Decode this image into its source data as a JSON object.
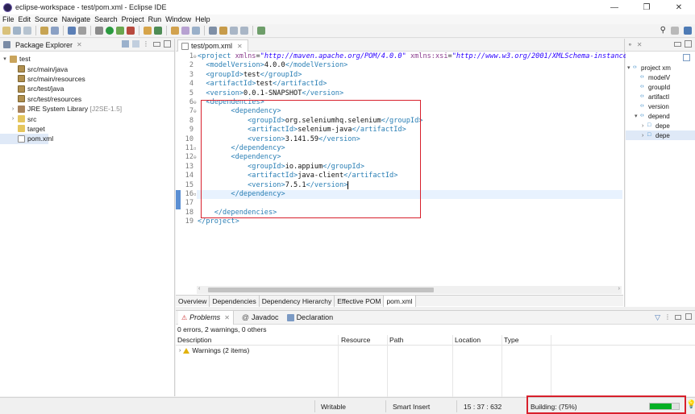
{
  "window": {
    "title": "eclipse-workspace - test/pom.xml - Eclipse IDE",
    "minimize": "—",
    "maximize": "❐",
    "close": "✕"
  },
  "menu": [
    "File",
    "Edit",
    "Source",
    "Navigate",
    "Search",
    "Project",
    "Run",
    "Window",
    "Help"
  ],
  "package_explorer": {
    "title": "Package Explorer",
    "items": [
      {
        "label": "test",
        "icon": "project-icon",
        "expanded": true,
        "level": 0
      },
      {
        "label": "src/main/java",
        "icon": "package-folder-icon",
        "level": 1
      },
      {
        "label": "src/main/resources",
        "icon": "package-folder-icon",
        "level": 1
      },
      {
        "label": "src/test/java",
        "icon": "package-folder-icon",
        "level": 1
      },
      {
        "label": "src/test/resources",
        "icon": "package-folder-icon",
        "level": 1
      },
      {
        "label": "JRE System Library",
        "suffix": "[J2SE-1.5]",
        "icon": "library-icon",
        "level": 1,
        "collapsed": true
      },
      {
        "label": "src",
        "icon": "folder-icon",
        "level": 1,
        "collapsed": true
      },
      {
        "label": "target",
        "icon": "folder-icon",
        "level": 1
      },
      {
        "label": "pom.xml",
        "icon": "xml-file-icon",
        "level": 1,
        "selected": true
      }
    ]
  },
  "editor": {
    "tab_label": "test/pom.xml",
    "lines": [
      "<project xmlns=\"http://maven.apache.org/POM/4.0.0\" xmlns:xsi=\"http://www.w3.org/2001/XMLSchema-instance\"",
      "  <modelVersion>4.0.0</modelVersion>",
      "  <groupId>test</groupId>",
      "  <artifactId>test</artifactId>",
      "  <version>0.0.1-SNAPSHOT</version>",
      "  <dependencies>",
      "        <dependency>",
      "            <groupId>org.seleniumhq.selenium</groupId>",
      "            <artifactId>selenium-java</artifactId>",
      "            <version>3.141.59</version>",
      "        </dependency>",
      "        <dependency>",
      "            <groupId>io.appium</groupId>",
      "            <artifactId>java-client</artifactId>",
      "            <version>7.5.1</version>",
      "        </dependency>",
      "",
      "    </dependencies>",
      "</project>"
    ],
    "line_numbers": [
      "1",
      "2",
      "3",
      "4",
      "5",
      "6",
      "7",
      "8",
      "9",
      "10",
      "11",
      "12",
      "13",
      "14",
      "15",
      "16",
      "17",
      "18",
      "19"
    ],
    "bottom_tabs": [
      "Overview",
      "Dependencies",
      "Dependency Hierarchy",
      "Effective POM",
      "pom.xml"
    ],
    "active_bottom_tab": "pom.xml"
  },
  "outline": {
    "items": [
      {
        "label": "project xm",
        "level": 0,
        "expanded": true
      },
      {
        "label": "modelV",
        "level": 1
      },
      {
        "label": "groupId",
        "level": 1
      },
      {
        "label": "artifactI",
        "level": 1
      },
      {
        "label": "version",
        "level": 1
      },
      {
        "label": "depend",
        "level": 1,
        "expanded": true
      },
      {
        "label": "depe",
        "level": 2
      },
      {
        "label": "depe",
        "level": 2,
        "selected": true
      }
    ]
  },
  "problems": {
    "tabs": [
      "Problems",
      "Javadoc",
      "Declaration"
    ],
    "summary": "0 errors, 2 warnings, 0 others",
    "columns": [
      "Description",
      "Resource",
      "Path",
      "Location",
      "Type"
    ],
    "rows": [
      {
        "description": "Warnings (2 items)"
      }
    ]
  },
  "status": {
    "writable": "Writable",
    "insert_mode": "Smart Insert",
    "position": "15 : 37 : 632",
    "building": "Building: (75%)",
    "progress": 0.75
  },
  "colors": {
    "accent": "#2a7fb5",
    "highlight": "#d8202c",
    "progress": "#06b025"
  }
}
